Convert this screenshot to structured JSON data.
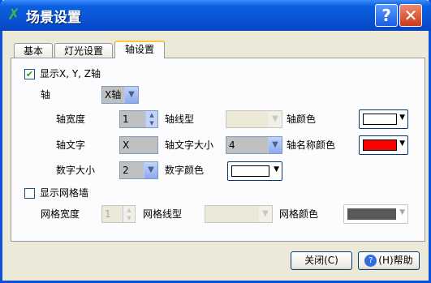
{
  "window": {
    "title": "场景设置"
  },
  "tabs": [
    {
      "label": "基本"
    },
    {
      "label": "灯光设置"
    },
    {
      "label": "轴设置"
    }
  ],
  "axis_settings": {
    "show_axes_label": "显示X, Y, Z轴",
    "show_axes_checked": true,
    "axis_label": "轴",
    "axis_select_value": "X轴",
    "axis_width_label": "轴宽度",
    "axis_width_value": "1",
    "axis_line_type_label": "轴线型",
    "axis_line_type_value": "",
    "axis_color_label": "轴颜色",
    "axis_color": "#ffffff",
    "axis_text_label": "轴文字",
    "axis_text_value": "X",
    "axis_text_size_label": "轴文字大小",
    "axis_text_size_value": "4",
    "axis_name_color_label": "轴名称颜色",
    "axis_name_color": "#ff0000",
    "number_size_label": "数字大小",
    "number_size_value": "2",
    "number_color_label": "数字颜色",
    "number_color": "#ffffff"
  },
  "grid_settings": {
    "show_grid_label": "显示网格墙",
    "show_grid_checked": false,
    "grid_width_label": "网格宽度",
    "grid_width_value": "1",
    "grid_line_type_label": "网格线型",
    "grid_line_type_value": "",
    "grid_color_label": "网格颜色",
    "grid_color": "#595959"
  },
  "footer": {
    "close_label": "关闭(C)",
    "help_label": "(H)帮助",
    "help_icon_glyph": "?"
  },
  "titlebar_buttons": {
    "help_glyph": "?",
    "close_glyph": "✕"
  }
}
